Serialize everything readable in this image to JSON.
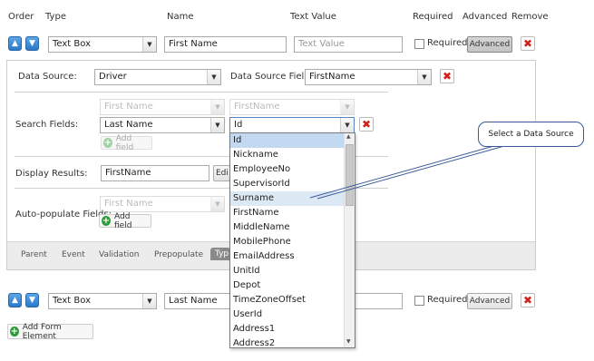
{
  "columns": {
    "order": "Order",
    "type": "Type",
    "name": "Name",
    "text_value": "Text Value",
    "required": "Required",
    "advanced": "Advanced",
    "remove": "Remove"
  },
  "row1": {
    "type_value": "Text Box",
    "name_value": "First Name",
    "text_value_placeholder": "Text Value",
    "required_label": "Required",
    "advanced_label": "Advanced"
  },
  "panel": {
    "data_source_label": "Data Source:",
    "data_source_value": "Driver",
    "data_source_field_label": "Data Source Field:",
    "data_source_field_value": "FirstName",
    "search_fields_label": "Search Fields:",
    "search_disabled_1": "First Name",
    "search_disabled_2": "FirstName",
    "search_field_value": "Last Name",
    "search_field2_value": "Id",
    "add_field_label": "Add field",
    "display_results_label": "Display Results:",
    "display_results_value": "FirstName",
    "display_results_button": "Edi",
    "autopopulate_label": "Auto-populate Fields:",
    "autopopulate_disabled": "First Name",
    "add_field_label2": "Add field",
    "tabs": [
      "Parent",
      "Event",
      "Validation",
      "Prepopulate",
      "Typ"
    ]
  },
  "dropdown": {
    "items": [
      "Id",
      "Nickname",
      "EmployeeNo",
      "SupervisorId",
      "Surname",
      "FirstName",
      "MiddleName",
      "MobilePhone",
      "EmailAddress",
      "UnitId",
      "Depot",
      "TimeZoneOffset",
      "UserId",
      "Address1",
      "Address2"
    ],
    "selected": "Id",
    "hovered": "Surname"
  },
  "callout": {
    "text": "Select a Data Source"
  },
  "row2": {
    "type_value": "Text Box",
    "name_value": "Last Name",
    "required_label": "Required",
    "advanced_label": "Advanced"
  },
  "add_form_element_label": "Add Form Element",
  "colors": {
    "accent_blue": "#2b78c8",
    "remove_red": "#d4201b",
    "add_green": "#2e9b3a",
    "selection": "#c3d9f1",
    "callout_line": "#3a5a9a"
  },
  "icons": {
    "move_up": "up-arrow-icon",
    "move_down": "down-arrow-icon",
    "remove": "close-icon",
    "add": "plus-icon",
    "dropdown": "chevron-down-icon"
  }
}
